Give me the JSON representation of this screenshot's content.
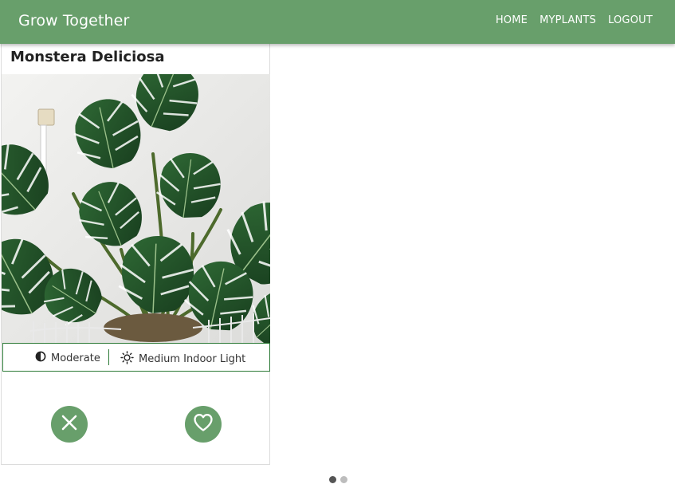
{
  "navbar": {
    "brand": "Grow Together",
    "links": [
      "HOME",
      "MYPLANTS",
      "LOGOUT"
    ],
    "background": "#689f6b"
  },
  "card": {
    "title": "Monstera Deliciosa",
    "image": {
      "subject": "monstera-plant-photo"
    },
    "care": {
      "water": {
        "icon": "half-circle-contrast-icon",
        "label": "Moderate"
      },
      "light": {
        "icon": "sun-icon",
        "label": "Medium Indoor Light"
      }
    },
    "actions": {
      "dislike_icon": "close-icon",
      "like_icon": "heart-icon",
      "button_color": "#689f6b"
    },
    "border_accent": "#2d7a37"
  },
  "pagination": {
    "total": 2,
    "active": 1
  }
}
